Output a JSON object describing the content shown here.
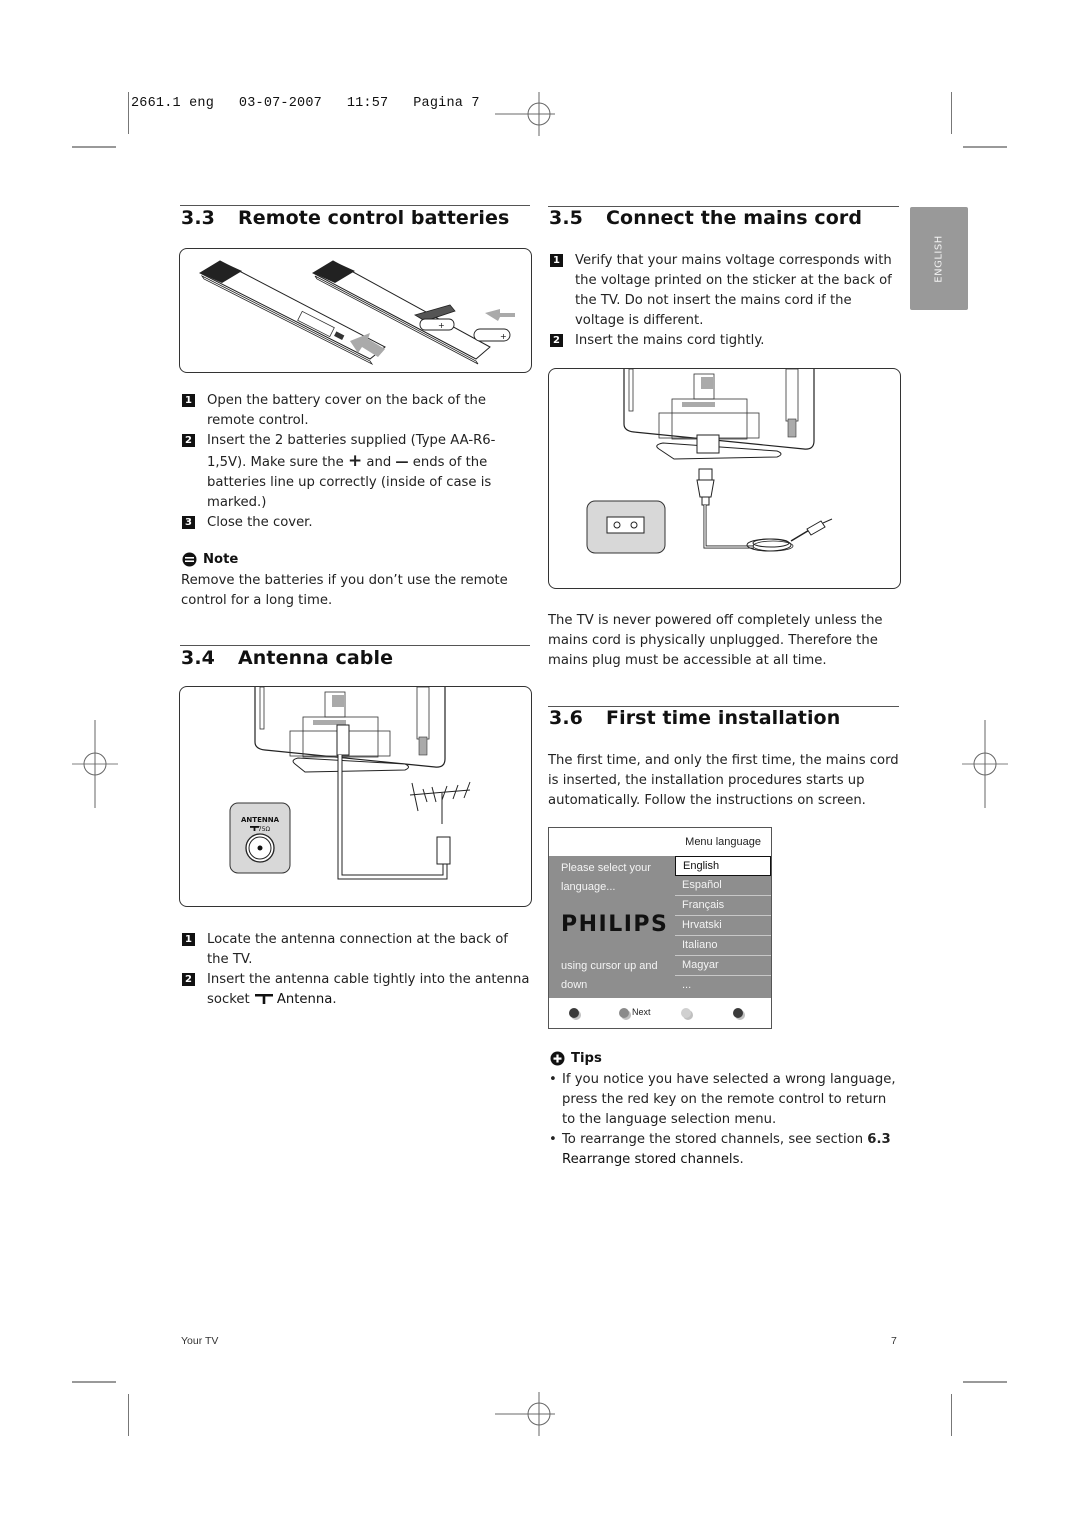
{
  "slug": "2661.1 eng   03-07-2007   11:57   Pagina 7",
  "language_tab": "ENGLISH",
  "sections": {
    "remote_batteries": {
      "number": "3.3",
      "title": "Remote control batteries",
      "steps": [
        {
          "num": "1",
          "text": "Open the battery cover on the back of the remote control."
        },
        {
          "num": "2",
          "text_a": "Insert the 2 batteries supplied (Type AA-R6-1,5V). Make sure the ",
          "plus": "+",
          "text_b": " and ",
          "minus": "—",
          "text_c": " ends of the batteries line up correctly (inside of case is marked.)"
        },
        {
          "num": "3",
          "text": "Close the cover."
        }
      ],
      "note_title": "Note",
      "note_text": "Remove the batteries if you don’t use the remote control for a long time."
    },
    "antenna_cable": {
      "number": "3.4",
      "title": "Antenna cable",
      "figure_label": "ANTENNA",
      "figure_sublabel": "75Ω",
      "steps": [
        {
          "num": "1",
          "text": "Locate the antenna connection at the back of the TV."
        },
        {
          "num": "2",
          "text_a": "Insert the antenna cable tightly into the antenna socket ",
          "icon": "antenna-socket-icon",
          "text_b": "Antenna",
          "text_c": "."
        }
      ]
    },
    "mains_cord": {
      "number": "3.5",
      "title": "Connect the mains cord",
      "steps": [
        {
          "num": "1",
          "text": "Verify that your mains voltage corresponds with the voltage printed on the sticker at the back of the TV. Do not insert the mains cord if the voltage is different."
        },
        {
          "num": "2",
          "text": "Insert the mains cord tightly."
        }
      ],
      "paragraph": "The TV is never powered off completely unless the mains cord is physically unplugged. Therefore the mains plug must be accessible at all time."
    },
    "first_install": {
      "number": "3.6",
      "title": "First time installation",
      "paragraph": "The first time, and only the first time, the mains cord is inserted, the installation procedures starts up automatically. Follow the instructions on screen.",
      "menu": {
        "header": "Menu language",
        "left_text_1": "Please select your",
        "left_text_2": "language...",
        "brand": "PHILIPS",
        "left_text_3": "using cursor up and",
        "left_text_4": "down",
        "options": [
          "English",
          "Español",
          "Français",
          "Hrvatski",
          "Italiano",
          "Magyar",
          "..."
        ],
        "selected": "English",
        "footer_label": "Next",
        "footer_dot_colors": [
          "#3a3a3a",
          "#8a8a8a",
          "#d0d0d0",
          "#3a3a3a"
        ]
      },
      "tips_title": "Tips",
      "tips": [
        {
          "text": "If you notice you have selected a wrong language, press the red key on the remote control to return to the language selection menu."
        },
        {
          "text_a": "To rearrange the stored channels, see section ",
          "bold_a": "6.3",
          "text_b": " ",
          "bold_b": "Rearrange stored channels",
          "text_c": "."
        }
      ]
    }
  },
  "footer": {
    "left": "Your TV",
    "page": "7"
  }
}
